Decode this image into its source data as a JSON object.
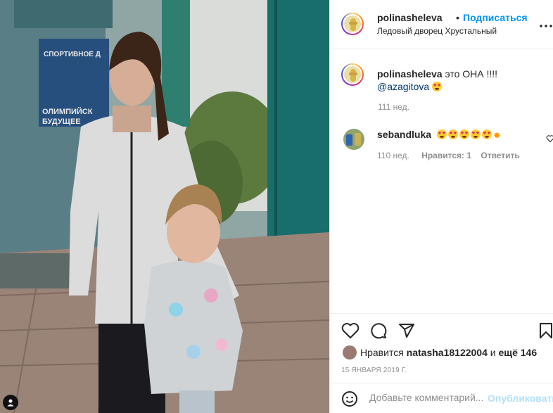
{
  "post": {
    "author": "polinasheleva",
    "separator": "•",
    "follow_label": "Подписаться",
    "location": "Ледовый дворец Хрустальный",
    "more_icon": "more-horizontal-icon"
  },
  "photo": {
    "sign_line1": "СПОРТИВНОЕ Д",
    "sign_line2": "ОЛИМПИЙСК",
    "sign_line3": "БУДУЩЕЕ"
  },
  "caption": {
    "author": "polinasheleva",
    "text": "это ОНА !!!!",
    "mention": "@azagitova",
    "time": "111 нед."
  },
  "comments": [
    {
      "author": "sebandluka",
      "emoji_count": 5,
      "time": "110 нед.",
      "likes": "Нравится: 1",
      "reply": "Ответить"
    }
  ],
  "likes": {
    "prefix": "Нравится",
    "user": "natasha18122004",
    "conj": "и",
    "others": "ещё 146"
  },
  "date": "15 ЯНВАРЯ 2019 Г.",
  "add_comment": {
    "placeholder": "Добавьте комментарий...",
    "publish_label": "Опубликовать"
  },
  "colors": {
    "accent": "#0095f6",
    "muted": "#8e8e8e",
    "text": "#262626",
    "publish_disabled": "#b2dffc"
  }
}
